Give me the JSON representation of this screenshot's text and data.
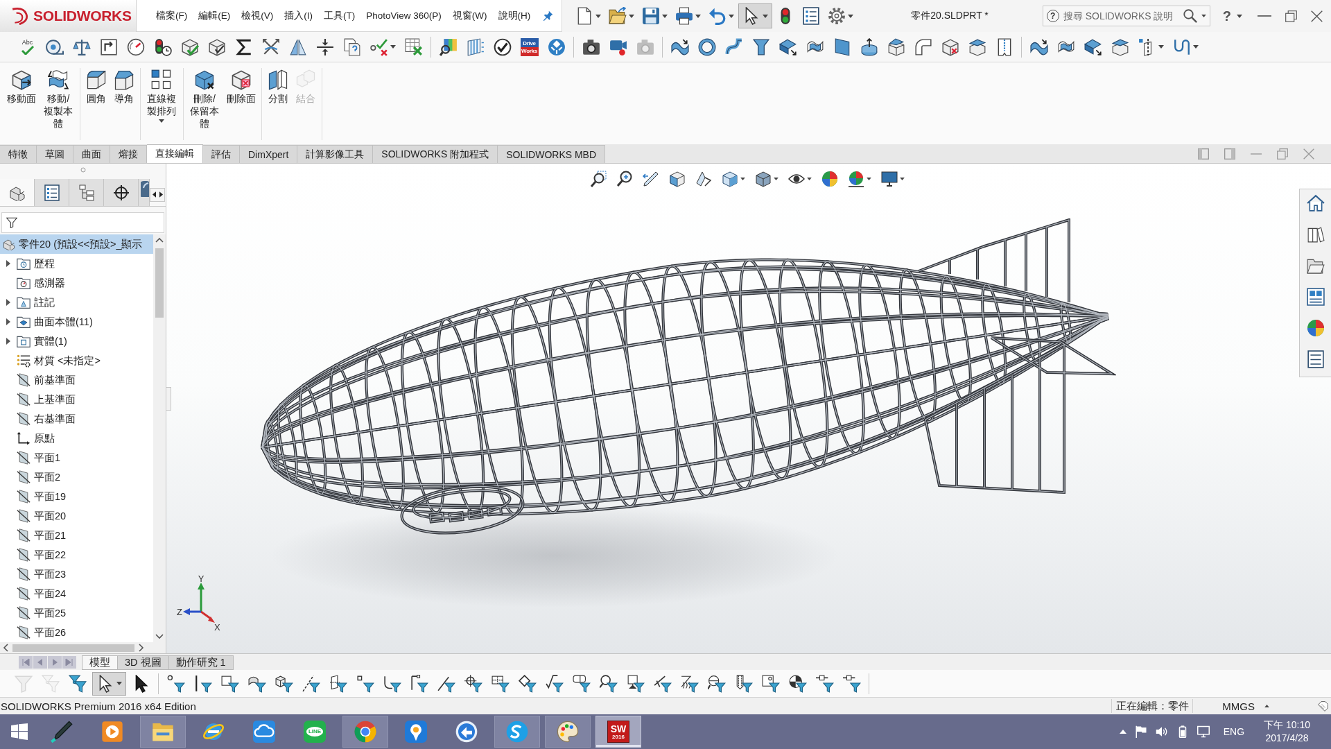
{
  "title_bar": {
    "logo": "SOLIDWORKS",
    "menu": [
      "檔案(F)",
      "編輯(E)",
      "檢視(V)",
      "插入(I)",
      "工具(T)",
      "PhotoView 360(P)",
      "視窗(W)",
      "說明(H)"
    ],
    "document_title": "零件20.SLDPRT *",
    "search": {
      "help_label": "?",
      "placeholder": "搜尋 SOLIDWORKS 說明"
    },
    "help_button": "?"
  },
  "standard_toolbar": [
    {
      "kind": "new",
      "dropdown": true,
      "selected": false
    },
    {
      "kind": "open",
      "dropdown": true,
      "selected": false
    },
    {
      "kind": "save",
      "dropdown": true,
      "selected": false
    },
    {
      "kind": "print",
      "dropdown": true,
      "selected": false
    },
    {
      "kind": "undo",
      "dropdown": true,
      "selected": false
    },
    {
      "kind": "select",
      "dropdown": true,
      "selected": true
    },
    {
      "kind": "rebuild",
      "dropdown": false,
      "selected": false
    },
    {
      "kind": "properties",
      "dropdown": false,
      "selected": false
    },
    {
      "kind": "options",
      "dropdown": true,
      "selected": false
    }
  ],
  "tools_toolbar": [
    [
      {
        "kind": "spell_check",
        "text": "Abc",
        "disabled": false,
        "dropdown": false
      },
      {
        "kind": "tape",
        "disabled": false,
        "dropdown": false
      },
      {
        "kind": "scale",
        "disabled": false,
        "dropdown": false
      },
      {
        "kind": "arrow_box",
        "disabled": false,
        "dropdown": false
      },
      {
        "kind": "gauge",
        "disabled": false,
        "dropdown": false
      },
      {
        "kind": "performance",
        "disabled": false,
        "dropdown": false
      },
      {
        "kind": "cube_check",
        "disabled": false,
        "dropdown": false
      },
      {
        "kind": "box_check",
        "disabled": false,
        "dropdown": false
      },
      {
        "kind": "sigma",
        "disabled": false,
        "dropdown": false
      },
      {
        "kind": "cross_arrows",
        "disabled": false,
        "dropdown": false
      },
      {
        "kind": "mirror",
        "disabled": false,
        "dropdown": false
      },
      {
        "kind": "compress",
        "disabled": false,
        "dropdown": false
      },
      {
        "kind": "documents",
        "disabled": false,
        "dropdown": false
      },
      {
        "kind": "check_cross",
        "disabled": false,
        "dropdown": true
      },
      {
        "kind": "table_cross",
        "disabled": false,
        "dropdown": false
      }
    ],
    [
      {
        "kind": "color_map",
        "disabled": false,
        "dropdown": false
      },
      {
        "kind": "striped_panel",
        "disabled": false,
        "dropdown": false
      },
      {
        "kind": "check_circle",
        "disabled": false,
        "dropdown": false
      },
      {
        "kind": "text_tile",
        "text": "Drive Works",
        "disabled": false,
        "dropdown": false
      },
      {
        "kind": "globe_arrows",
        "disabled": false,
        "dropdown": false
      }
    ],
    [
      {
        "kind": "camera",
        "disabled": false,
        "dropdown": false
      },
      {
        "kind": "video_camera",
        "disabled": false,
        "dropdown": false
      },
      {
        "kind": "camera",
        "disabled": true,
        "dropdown": false
      }
    ],
    [
      {
        "kind": "wave_arrow",
        "disabled": false,
        "dropdown": false
      },
      {
        "kind": "ring",
        "disabled": false,
        "dropdown": false
      },
      {
        "kind": "s_curve",
        "disabled": false,
        "dropdown": false
      },
      {
        "kind": "funnel_shape",
        "disabled": false,
        "dropdown": false
      },
      {
        "kind": "twisted_sheet",
        "disabled": false,
        "dropdown": false
      },
      {
        "kind": "patch",
        "disabled": false,
        "dropdown": false
      },
      {
        "kind": "flat_sheet",
        "disabled": false,
        "dropdown": false
      },
      {
        "kind": "cylinder_arrow",
        "disabled": false,
        "dropdown": false
      },
      {
        "kind": "open_box",
        "disabled": false,
        "dropdown": false
      },
      {
        "kind": "bent_pipe",
        "disabled": false,
        "dropdown": false
      },
      {
        "kind": "cube_cross",
        "disabled": false,
        "dropdown": false
      },
      {
        "kind": "lidded_box",
        "disabled": false,
        "dropdown": false
      },
      {
        "kind": "zipper",
        "disabled": false,
        "dropdown": false
      }
    ],
    [
      {
        "kind": "wave_arrow",
        "disabled": false,
        "dropdown": false
      },
      {
        "kind": "patch",
        "disabled": false,
        "dropdown": false
      },
      {
        "kind": "twisted_sheet",
        "disabled": false,
        "dropdown": false
      },
      {
        "kind": "lidded_box",
        "disabled": false,
        "dropdown": false
      },
      {
        "kind": "split_line",
        "disabled": false,
        "dropdown": true
      },
      {
        "kind": "hook_curve",
        "disabled": false,
        "dropdown": true
      }
    ]
  ],
  "ribbon": [
    {
      "commands": [
        {
          "kind": "move_face",
          "label": "移動面",
          "disabled": false,
          "dropdown": false
        },
        {
          "kind": "move_copy",
          "label": "移動/複製本體",
          "disabled": false,
          "dropdown": false
        }
      ]
    },
    {
      "commands": [
        {
          "kind": "fillet",
          "label": "圓角",
          "disabled": false,
          "dropdown": false
        },
        {
          "kind": "chamfer",
          "label": "導角",
          "disabled": false,
          "dropdown": false
        }
      ]
    },
    {
      "commands": [
        {
          "kind": "linear_pattern",
          "label": "直線複製排列",
          "disabled": false,
          "dropdown": true
        }
      ]
    },
    {
      "commands": [
        {
          "kind": "delete_body",
          "label": "刪除/保留本體",
          "disabled": false,
          "dropdown": false
        },
        {
          "kind": "delete_face",
          "label": "刪除面",
          "disabled": false,
          "dropdown": false
        }
      ]
    },
    {
      "commands": [
        {
          "kind": "split",
          "label": "分割",
          "disabled": false,
          "dropdown": false
        },
        {
          "kind": "combine",
          "label": "結合",
          "disabled": true,
          "dropdown": false
        }
      ]
    }
  ],
  "command_tabs": [
    {
      "label": "特徵",
      "selected": false
    },
    {
      "label": "草圖",
      "selected": false
    },
    {
      "label": "曲面",
      "selected": false
    },
    {
      "label": "熔接",
      "selected": false
    },
    {
      "label": "直接編輯",
      "selected": true
    },
    {
      "label": "評估",
      "selected": false
    },
    {
      "label": "DimXpert",
      "selected": false
    },
    {
      "label": "計算影像工具",
      "selected": false
    },
    {
      "label": "SOLIDWORKS 附加程式",
      "selected": false
    },
    {
      "label": "SOLIDWORKS MBD",
      "selected": false
    }
  ],
  "left_panel": {
    "manager_tabs": [
      {
        "kind": "feature",
        "selected": true
      },
      {
        "kind": "property",
        "selected": false
      },
      {
        "kind": "configuration",
        "selected": false
      },
      {
        "kind": "dimxpert",
        "selected": false
      },
      {
        "kind": "display",
        "selected": false
      }
    ],
    "tree": {
      "label": "零件20 (預設<<預設>_顯示",
      "selected": true,
      "children": [
        {
          "label": "歷程",
          "kind": "history",
          "expandable": true,
          "selected": false
        },
        {
          "label": "感測器",
          "kind": "sensor",
          "expandable": false,
          "selected": false
        },
        {
          "label": "註記",
          "kind": "annotation",
          "expandable": true,
          "selected": false
        },
        {
          "label": "曲面本體(11)",
          "kind": "surface_body",
          "expandable": true,
          "selected": false
        },
        {
          "label": "實體(1)",
          "kind": "solid_body",
          "expandable": true,
          "selected": false
        },
        {
          "label": "材質 <未指定>",
          "kind": "material",
          "expandable": false,
          "selected": false
        },
        {
          "label": "前基準面",
          "kind": "plane",
          "expandable": false,
          "selected": false
        },
        {
          "label": "上基準面",
          "kind": "plane",
          "expandable": false,
          "selected": false
        },
        {
          "label": "右基準面",
          "kind": "plane",
          "expandable": false,
          "selected": false
        },
        {
          "label": "原點",
          "kind": "origin",
          "expandable": false,
          "selected": false
        },
        {
          "label": "平面1",
          "kind": "plane",
          "expandable": false,
          "selected": false
        },
        {
          "label": "平面2",
          "kind": "plane",
          "expandable": false,
          "selected": false
        },
        {
          "label": "平面19",
          "kind": "plane",
          "expandable": false,
          "selected": false
        },
        {
          "label": "平面20",
          "kind": "plane",
          "expandable": false,
          "selected": false
        },
        {
          "label": "平面21",
          "kind": "plane",
          "expandable": false,
          "selected": false
        },
        {
          "label": "平面22",
          "kind": "plane",
          "expandable": false,
          "selected": false
        },
        {
          "label": "平面23",
          "kind": "plane",
          "expandable": false,
          "selected": false
        },
        {
          "label": "平面24",
          "kind": "plane",
          "expandable": false,
          "selected": false
        },
        {
          "label": "平面25",
          "kind": "plane",
          "expandable": false,
          "selected": false
        },
        {
          "label": "平面26",
          "kind": "plane",
          "expandable": false,
          "selected": false
        }
      ]
    }
  },
  "viewport": {
    "triad": {
      "x": "X",
      "y": "Y",
      "z": "Z"
    }
  },
  "bottom_tabs": [
    {
      "label": "模型",
      "selected": true
    },
    {
      "label": "3D 視圖",
      "selected": false
    },
    {
      "label": "動作研究 1",
      "selected": false
    }
  ],
  "selection_toolbar": [
    [
      {
        "kind": "clear_filter",
        "disabled": true,
        "selected": false,
        "dropdown": false
      },
      {
        "kind": "filter_stack",
        "disabled": true,
        "selected": false,
        "dropdown": false
      },
      {
        "kind": "toggle_filters",
        "disabled": false,
        "selected": false,
        "dropdown": false
      },
      {
        "kind": "select",
        "disabled": false,
        "selected": true,
        "dropdown": true
      },
      {
        "kind": "select_through",
        "disabled": false,
        "selected": false,
        "dropdown": false
      }
    ],
    [
      {
        "kind": "dot",
        "disabled": false,
        "selected": false,
        "dropdown": false
      },
      {
        "kind": "line",
        "disabled": false,
        "selected": false,
        "dropdown": false
      },
      {
        "kind": "square",
        "disabled": false,
        "selected": false,
        "dropdown": false
      },
      {
        "kind": "sheet",
        "disabled": false,
        "selected": false,
        "dropdown": false
      },
      {
        "kind": "cube",
        "disabled": false,
        "selected": false,
        "dropdown": false
      },
      {
        "kind": "dashed_line",
        "disabled": false,
        "selected": false,
        "dropdown": false
      },
      {
        "kind": "plane",
        "disabled": false,
        "selected": false,
        "dropdown": false
      },
      {
        "kind": "small_square",
        "disabled": false,
        "selected": false,
        "dropdown": false
      },
      {
        "kind": "corner",
        "disabled": false,
        "selected": false,
        "dropdown": false
      },
      {
        "kind": "bracket",
        "disabled": false,
        "selected": false,
        "dropdown": false
      },
      {
        "kind": "slash",
        "disabled": false,
        "selected": false,
        "dropdown": false
      },
      {
        "kind": "crosshair",
        "disabled": false,
        "selected": false,
        "dropdown": false
      },
      {
        "kind": "grid",
        "disabled": false,
        "selected": false,
        "dropdown": false
      },
      {
        "kind": "diamond",
        "disabled": false,
        "selected": false,
        "dropdown": false
      },
      {
        "kind": "check_root",
        "disabled": false,
        "selected": false,
        "dropdown": false
      },
      {
        "kind": "rounded_rect",
        "disabled": false,
        "selected": false,
        "dropdown": false
      },
      {
        "kind": "magnifier",
        "disabled": false,
        "selected": false,
        "dropdown": false
      },
      {
        "kind": "flagged_box",
        "disabled": false,
        "selected": false,
        "dropdown": false
      },
      {
        "kind": "crossed_lines",
        "disabled": false,
        "selected": false,
        "dropdown": false
      },
      {
        "kind": "hatch",
        "disabled": false,
        "selected": false,
        "dropdown": false
      },
      {
        "kind": "circle_target",
        "disabled": false,
        "selected": false,
        "dropdown": false
      },
      {
        "kind": "cylinder",
        "disabled": false,
        "selected": false,
        "dropdown": false
      },
      {
        "kind": "square_circle",
        "disabled": false,
        "selected": false,
        "dropdown": false
      },
      {
        "kind": "quartered_circle",
        "disabled": false,
        "selected": false,
        "dropdown": false
      },
      {
        "kind": "bar_square",
        "disabled": false,
        "selected": false,
        "dropdown": false
      },
      {
        "kind": "bar_square",
        "disabled": false,
        "selected": false,
        "dropdown": false
      }
    ]
  ],
  "status_bar": {
    "edition": "SOLIDWORKS Premium 2016 x64 Edition",
    "editing": "正在編輯：零件",
    "units": "MMGS"
  },
  "taskbar": {
    "apps": [
      {
        "kind": "pen",
        "running": false,
        "active": false
      },
      {
        "kind": "play_tile",
        "running": false,
        "active": false
      },
      {
        "kind": "folder",
        "running": true,
        "active": false
      },
      {
        "kind": "globe_orbit",
        "running": false,
        "active": false
      },
      {
        "kind": "cloud",
        "running": false,
        "active": false
      },
      {
        "kind": "chat",
        "text": "LINE",
        "running": false,
        "active": false
      },
      {
        "kind": "tricolor",
        "running": true,
        "active": false
      },
      {
        "kind": "pin",
        "running": false,
        "active": false
      },
      {
        "kind": "arrow_circle",
        "running": false,
        "active": false
      },
      {
        "kind": "s_circle",
        "running": true,
        "active": false
      },
      {
        "kind": "palette",
        "running": true,
        "active": false
      },
      {
        "kind": "app_tile",
        "text": "SW",
        "subtext": "2016",
        "running": true,
        "active": true
      }
    ],
    "language": "ENG",
    "time": "下午 10:10",
    "date": "2017/4/28"
  }
}
